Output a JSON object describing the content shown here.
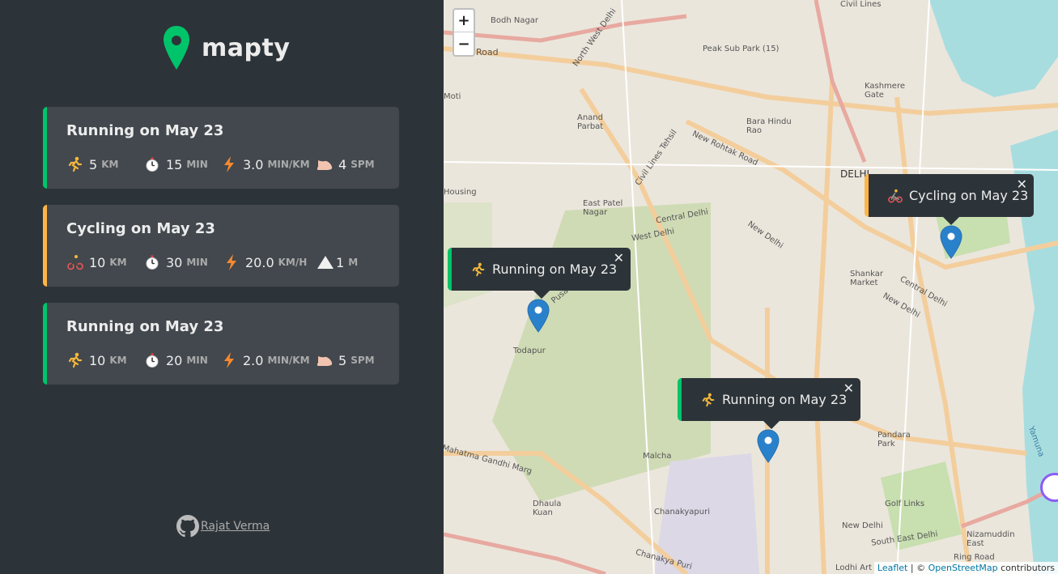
{
  "app": {
    "name": "mapty"
  },
  "workouts": [
    {
      "type": "running",
      "title": "Running on May 23",
      "distance": "5",
      "distance_unit": "km",
      "duration": "15",
      "duration_unit": "min",
      "pace": "3.0",
      "pace_unit": "min/km",
      "cadence": "4",
      "cadence_unit": "spm"
    },
    {
      "type": "cycling",
      "title": "Cycling on May 23",
      "distance": "10",
      "distance_unit": "km",
      "duration": "30",
      "duration_unit": "min",
      "speed": "20.0",
      "speed_unit": "km/h",
      "elevation": "1",
      "elevation_unit": "m"
    },
    {
      "type": "running",
      "title": "Running on May 23",
      "distance": "10",
      "distance_unit": "km",
      "duration": "20",
      "duration_unit": "min",
      "pace": "2.0",
      "pace_unit": "min/km",
      "cadence": "5",
      "cadence_unit": "spm"
    }
  ],
  "footer": {
    "author": "Rajat Verma"
  },
  "map": {
    "zoom_in": "+",
    "zoom_out": "−",
    "popups": [
      {
        "label": "Cycling on May 23",
        "close": "✕"
      },
      {
        "label": "Running on May 23",
        "close": "✕"
      },
      {
        "label": "Running on May 23",
        "close": "✕"
      }
    ],
    "places": {
      "bodh_nagar": "Bodh Nagar",
      "peak_sub_park": "Peak Sub Park (15)",
      "civil_lines": "Civil Lines",
      "kashmere_gate": "Kashmere Gate",
      "road": "Road",
      "north_west_delhi": "North West Delhi",
      "moti": "Moti",
      "anand_parbat": "Anand Parbat",
      "bara_hindu_rao": "Bara Hindu Rao",
      "new_rohtak_road": "New Rohtak Road",
      "civil_lines_tehsil": "Civil Lines Tehsil",
      "delhi": "DELHI",
      "east_patel_nagar": "East Patel Nagar",
      "central_delhi": "Central Delhi",
      "west_delhi": "West Delhi",
      "new_delhi": "New Delhi",
      "housing": "Housing",
      "shankar_market": "Shankar Market",
      "central_delhi_2": "Central Delhi",
      "new_delhi_2": "New Delhi",
      "pusa": "Pusa",
      "todapur": "Todapur",
      "mahatma_gandhi_marg": "Mahatma Gandhi Marg",
      "malcha": "Malcha",
      "pandara_park": "Pandara Park",
      "yamuna": "Yamuna",
      "dhaula_kuan": "Dhaula Kuan",
      "chanakyapuri": "Chanakyapuri",
      "golf_links": "Golf Links",
      "new_delhi_3": "New Delhi",
      "south_east_delhi": "South East Delhi",
      "nizamuddin_east": "Nizamuddin East",
      "chanakya_puri": "Chanakya Puri",
      "lodhi_art": "Lodhi Art",
      "ring_road": "Ring Road"
    },
    "attribution": {
      "leaflet": "Leaflet",
      "separator": " | © ",
      "osm": "OpenStreetMap",
      "contributors": " contributors"
    }
  }
}
